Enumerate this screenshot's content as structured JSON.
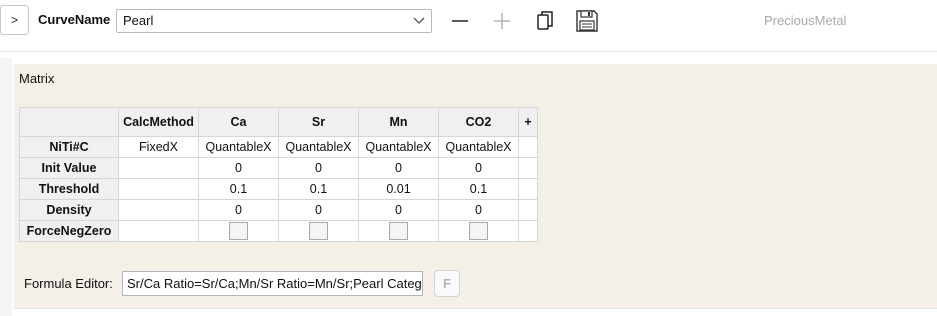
{
  "toolbar": {
    "expand_label": ">",
    "curve_label": "CurveName",
    "curve_value": "Pearl",
    "brand": "PreciousMetal"
  },
  "icons": {
    "dropdown": "chevron-down-icon",
    "remove": "minus-icon",
    "add": "plus-icon",
    "copy": "copy-icon",
    "save": "save-icon"
  },
  "matrix": {
    "title": "Matrix",
    "columns": [
      "CalcMethod",
      "Ca",
      "Sr",
      "Mn",
      "CO2"
    ],
    "add_column": "+",
    "rows": [
      {
        "label": "NiTi#C",
        "cells": [
          "FixedX",
          "QuantableX",
          "QuantableX",
          "QuantableX",
          "QuantableX"
        ]
      },
      {
        "label": "Init Value",
        "cells": [
          "",
          "0",
          "0",
          "0",
          "0"
        ]
      },
      {
        "label": "Threshold",
        "cells": [
          "",
          "0.1",
          "0.1",
          "0.01",
          "0.1"
        ]
      },
      {
        "label": "Density",
        "cells": [
          "",
          "0",
          "0",
          "0",
          "0"
        ]
      },
      {
        "label": "ForceNegZero",
        "cells": [
          "",
          "",
          "",
          "",
          ""
        ]
      }
    ],
    "force_neg_zero": [
      false,
      false,
      false,
      false
    ]
  },
  "formula": {
    "label": "Formula Editor:",
    "value": "Sr/Ca Ratio=Sr/Ca;Mn/Sr Ratio=Mn/Sr;Pearl Categ",
    "button": "F"
  },
  "colors": {
    "panel_bg": "#f4efe7",
    "header_bg": "#f0f0f0",
    "muted_text": "#a9a9a9"
  }
}
